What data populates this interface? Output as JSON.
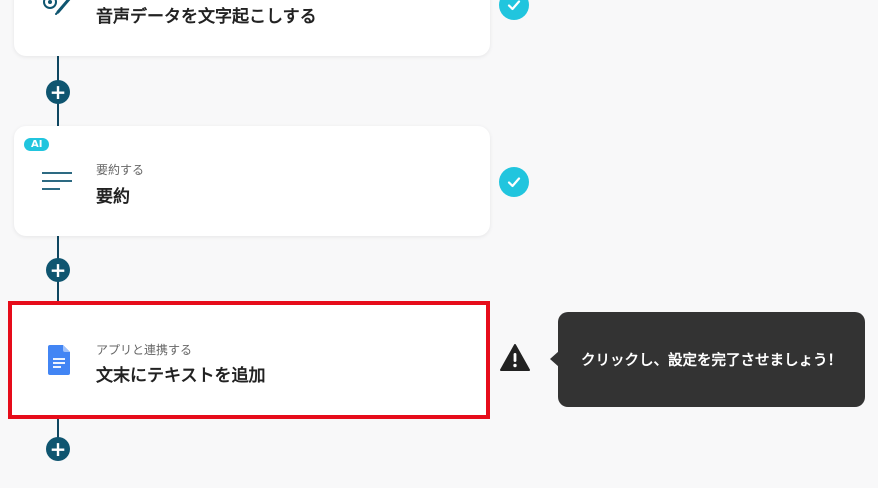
{
  "steps": [
    {
      "title": "音声データを文字起こしする",
      "status_icon": "check-icon",
      "step_icon": "transcribe-icon"
    },
    {
      "badge": "AI",
      "subtitle": "要約する",
      "title": "要約",
      "status_icon": "check-icon",
      "step_icon": "summary-lines-icon"
    },
    {
      "subtitle": "アプリと連携する",
      "title": "文末にテキストを追加",
      "status_icon": "warning-icon",
      "step_icon": "google-docs-icon"
    }
  ],
  "tooltip": {
    "text": "クリックし、設定を完了させましょう！"
  },
  "colors": {
    "accent": "#21c5de",
    "connector": "#0f5570",
    "highlight": "#e60c1a",
    "tooltip_bg": "#333333",
    "docs_blue": "#4285f4"
  }
}
